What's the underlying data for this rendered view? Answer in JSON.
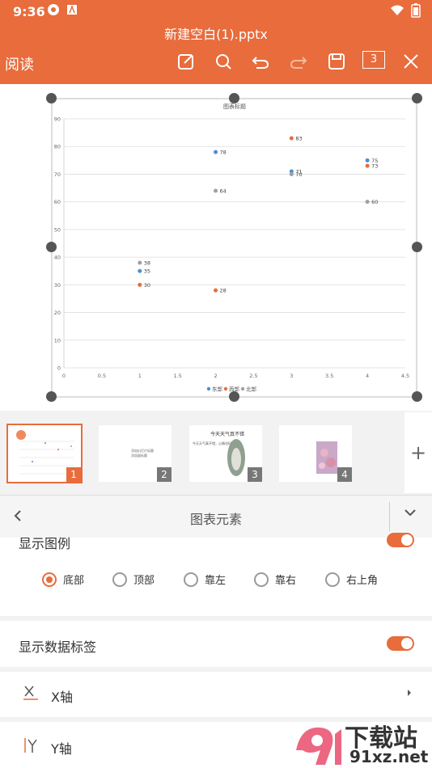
{
  "status": {
    "time": "9:36"
  },
  "header": {
    "doc_title": "新建空白(1).pptx",
    "mode_label": "阅读",
    "slide_count": "3"
  },
  "colors": {
    "accent": "#e86c3c",
    "series_east": "#4a8fd4",
    "series_west": "#e86c3c",
    "series_north": "#a0a0a0"
  },
  "chart_data": {
    "type": "scatter",
    "title": "图表标题",
    "xlim": [
      0,
      4.5
    ],
    "ylim": [
      0,
      90
    ],
    "x_ticks": [
      "0",
      "0.5",
      "1",
      "1.5",
      "2",
      "2.5",
      "3",
      "3.5",
      "4",
      "4.5"
    ],
    "y_ticks": [
      "0",
      "10",
      "20",
      "30",
      "40",
      "50",
      "60",
      "70",
      "80",
      "90"
    ],
    "grid": true,
    "legend_position": "bottom",
    "series": [
      {
        "name": "东部",
        "color": "#4a8fd4",
        "points": [
          {
            "x": 1,
            "y": 35
          },
          {
            "x": 2,
            "y": 78
          },
          {
            "x": 3,
            "y": 71
          },
          {
            "x": 4,
            "y": 75
          }
        ]
      },
      {
        "name": "西部",
        "color": "#e86c3c",
        "points": [
          {
            "x": 1,
            "y": 30
          },
          {
            "x": 2,
            "y": 28
          },
          {
            "x": 3,
            "y": 83
          },
          {
            "x": 4,
            "y": 73
          }
        ]
      },
      {
        "name": "北部",
        "color": "#a0a0a0",
        "points": [
          {
            "x": 1,
            "y": 38
          },
          {
            "x": 2,
            "y": 64
          },
          {
            "x": 3,
            "y": 70
          },
          {
            "x": 4,
            "y": 60
          }
        ]
      }
    ]
  },
  "thumbnails": [
    {
      "num": "1",
      "active": true
    },
    {
      "num": "2",
      "text": "添加幻灯片标题",
      "sub": "添加副标题"
    },
    {
      "num": "3",
      "title": "今天天气真不错",
      "sub": "今天天气真不错，心情也好"
    },
    {
      "num": "4"
    }
  ],
  "add_slide_label": "+",
  "panel": {
    "title": "图表元素",
    "show_legend": "显示图例",
    "legend_positions": [
      "底部",
      "顶部",
      "靠左",
      "靠右",
      "右上角"
    ],
    "legend_selected": "底部",
    "show_data_labels": "显示数据标签",
    "x_axis": "X轴",
    "y_axis": "Y轴"
  },
  "watermark": {
    "text": "下载站",
    "url": "91xz.net"
  }
}
